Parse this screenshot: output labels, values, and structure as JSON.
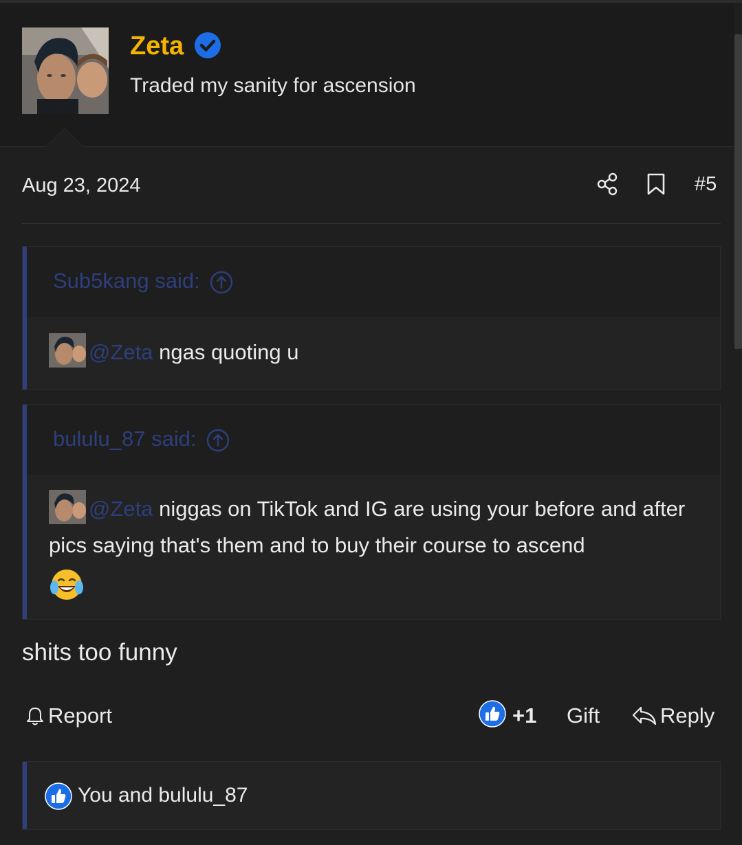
{
  "author": {
    "name": "Zeta",
    "tagline": "Traded my sanity for ascension",
    "verified": true
  },
  "post": {
    "date": "Aug 23, 2024",
    "number": "#5",
    "message": "shits too funny"
  },
  "quotes": [
    {
      "attribution": "Sub5kang said:",
      "mention": "@Zeta",
      "text": " ngas quoting u"
    },
    {
      "attribution": "bululu_87 said:",
      "mention": "@Zeta",
      "text": " niggas on TikTok and IG are using your before and after pics saying that's them and to buy their course to ascend",
      "emoji": "face-with-tears-of-joy"
    }
  ],
  "actions": {
    "report": "Report",
    "like_count": "+1",
    "gift": "Gift",
    "reply": "Reply"
  },
  "reactions": {
    "text": "You and bululu_87"
  },
  "colors": {
    "background": "#1f1f1f",
    "username": "#f5b400",
    "accent": "#1d6ee6",
    "quote_link": "#2d3f7c"
  }
}
